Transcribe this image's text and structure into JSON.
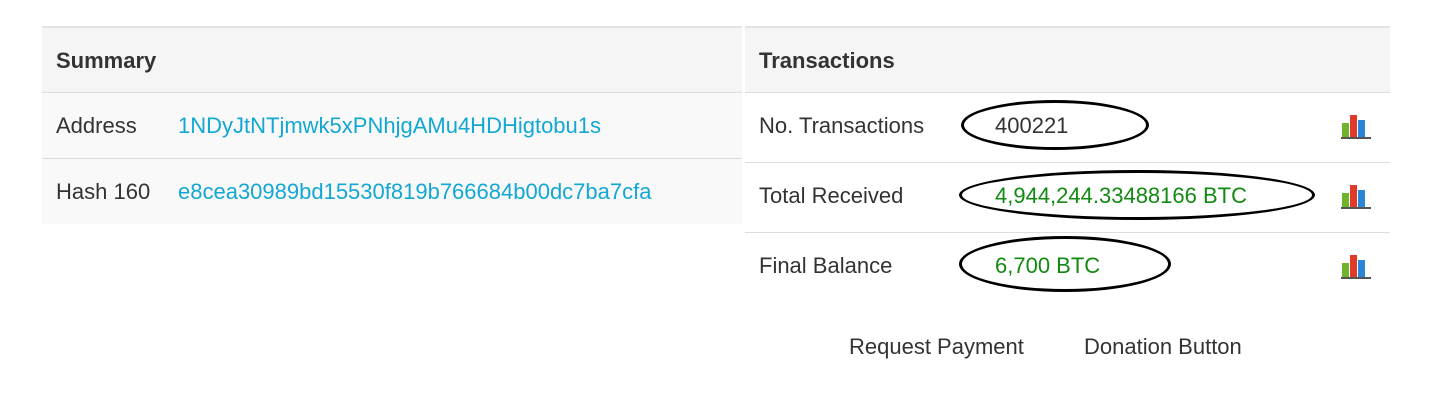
{
  "summary": {
    "header": "Summary",
    "rows": [
      {
        "label": "Address",
        "value": "1NDyJtNTjmwk5xPNhjgAMu4HDHigtobu1s"
      },
      {
        "label": "Hash 160",
        "value": "e8cea30989bd15530f819b766684b00dc7ba7cfa"
      }
    ]
  },
  "transactions": {
    "header": "Transactions",
    "rows": [
      {
        "label": "No. Transactions",
        "value": "400221",
        "icon": "bar-chart-icon"
      },
      {
        "label": "Total Received",
        "value": "4,944,244.33488166 BTC",
        "icon": "bar-chart-icon"
      },
      {
        "label": "Final Balance",
        "value": "6,700 BTC",
        "icon": "bar-chart-icon"
      }
    ]
  },
  "actions": {
    "request_payment": "Request Payment",
    "donation_button": "Donation Button"
  },
  "colors": {
    "link": "#13a7d3",
    "positive_amount": "#128a12",
    "annotation_outline": "#000000"
  }
}
